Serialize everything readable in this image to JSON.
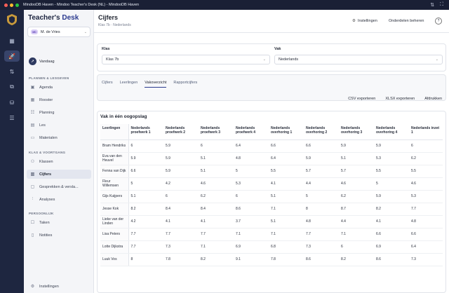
{
  "window": {
    "title": "MindooDB Haven - Mindoo Teacher's Desk (NL) - MindooDB Haven"
  },
  "brand": {
    "part1": "Teacher's ",
    "part2": "Desk"
  },
  "user": {
    "initials": "MD",
    "name": "M. de Vries"
  },
  "sidebar": {
    "today": "Vandaag",
    "section1": "PLANNEN & LESGEVEN",
    "section2": "KLAS & VOORTGANG",
    "section3": "PERSOONLIJK",
    "items": [
      {
        "label": "Agenda",
        "icon": "calendar-icon"
      },
      {
        "label": "Rooster",
        "icon": "grid-icon"
      },
      {
        "label": "Planning",
        "icon": "list-icon"
      },
      {
        "label": "Les",
        "icon": "file-icon"
      },
      {
        "label": "Materialen",
        "icon": "folder-icon"
      },
      {
        "label": "Klassen",
        "icon": "users-icon"
      },
      {
        "label": "Cijfers",
        "icon": "chart-icon"
      },
      {
        "label": "Gesprekken & versla...",
        "icon": "chat-icon"
      },
      {
        "label": "Analyses",
        "icon": "analytics-icon"
      },
      {
        "label": "Taken",
        "icon": "task-icon"
      },
      {
        "label": "Notities",
        "icon": "note-icon"
      }
    ],
    "settings": "Instellingen"
  },
  "header": {
    "title": "Cijfers",
    "breadcrumb": "Klas 7b · Nederlands",
    "settings_btn": "Instellingen",
    "manage_btn": "Onderdelen beheren",
    "help": "?"
  },
  "filters": {
    "klas_label": "Klas",
    "klas_value": "Klas 7b",
    "vak_label": "Vak",
    "vak_value": "Nederlands"
  },
  "tabs": [
    "Cijfers",
    "Leerlingen",
    "Vakoverzicht",
    "Rapportcijfers"
  ],
  "actions": {
    "csv": "CSV exporteren",
    "xlsx": "XLSX exporteren",
    "print": "Afdrukken"
  },
  "table": {
    "title": "Vak in één oogopslag",
    "headers": [
      "Leerlingen",
      "Nederlands proefwerk 1",
      "Nederlands proefwerk 2",
      "Nederlands proefwerk 3",
      "Nederlands proefwerk 4",
      "Nederlands overhoring 1",
      "Nederlands overhoring 2",
      "Nederlands overhoring 3",
      "Nederlands overhoring 4",
      "Nederlands inzet 1"
    ],
    "rows": [
      [
        "Bram Hendriks",
        "6",
        "5.9",
        "6",
        "6.4",
        "6.6",
        "6.6",
        "5.9",
        "5.9",
        "6"
      ],
      [
        "Eva van den Heuvel",
        "5.9",
        "5.9",
        "5.1",
        "4.8",
        "6.4",
        "5.9",
        "5.1",
        "5.3",
        "6.2"
      ],
      [
        "Fenna van Dijk",
        "6.6",
        "5.9",
        "5.1",
        "5",
        "5.5",
        "5.7",
        "5.7",
        "5.5",
        "5.5"
      ],
      [
        "Fleur Willemsen",
        "5",
        "4.2",
        "4.6",
        "5.3",
        "4.1",
        "4.4",
        "4.6",
        "5",
        "4.6"
      ],
      [
        "Gijs Kuijpers",
        "5.1",
        "6",
        "6.2",
        "6",
        "5.1",
        "5",
        "6.2",
        "5.9",
        "5.3"
      ],
      [
        "Jesse Kok",
        "8.2",
        "8.4",
        "8.4",
        "8.6",
        "7.1",
        "8",
        "8.7",
        "8.2",
        "7.7"
      ],
      [
        "Lieke van der Linden",
        "4.2",
        "4.1",
        "4.1",
        "3.7",
        "5.1",
        "4.8",
        "4.4",
        "4.1",
        "4.8"
      ],
      [
        "Lisa Peters",
        "7.7",
        "7.7",
        "7.7",
        "7.1",
        "7.1",
        "7.7",
        "7.1",
        "6.6",
        "6.6"
      ],
      [
        "Lotte Dijkstra",
        "7.7",
        "7.3",
        "7.1",
        "6.9",
        "6.8",
        "7.3",
        "6",
        "6.9",
        "6.4"
      ],
      [
        "Luuk Vos",
        "8",
        "7.8",
        "8.2",
        "9.1",
        "7.8",
        "8.6",
        "8.2",
        "8.6",
        "7.3"
      ]
    ]
  }
}
